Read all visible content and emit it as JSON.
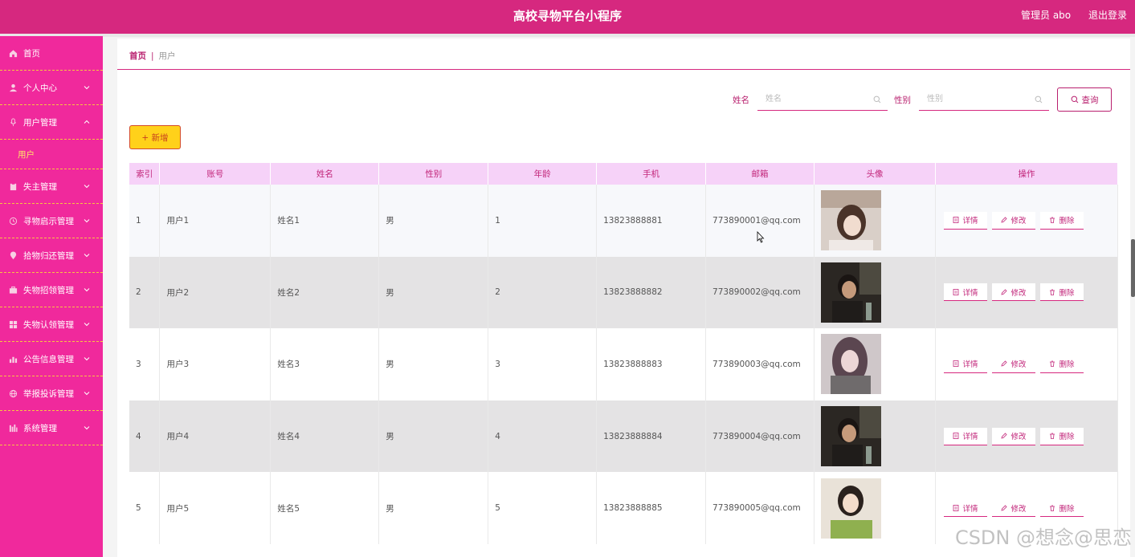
{
  "header": {
    "title": "高校寻物平台小程序",
    "admin": "管理员 abo",
    "logout": "退出登录"
  },
  "sidebar": {
    "items": [
      {
        "label": "首页",
        "icon": "home-icon"
      },
      {
        "label": "个人中心",
        "icon": "person-icon"
      },
      {
        "label": "用户管理",
        "icon": "mic-icon",
        "expanded": true,
        "sub": "用户"
      },
      {
        "label": "失主管理",
        "icon": "clipboard-icon"
      },
      {
        "label": "寻物启示管理",
        "icon": "clock-icon"
      },
      {
        "label": "拾物归还管理",
        "icon": "pin-icon"
      },
      {
        "label": "失物招领管理",
        "icon": "briefcase-icon"
      },
      {
        "label": "失物认领管理",
        "icon": "grid-icon"
      },
      {
        "label": "公告信息管理",
        "icon": "chart-icon"
      },
      {
        "label": "举报投诉管理",
        "icon": "globe-icon"
      },
      {
        "label": "系统管理",
        "icon": "bars-icon"
      }
    ]
  },
  "breadcrumb": {
    "home": "首页",
    "separator": "|",
    "current": "用户"
  },
  "search": {
    "name_label": "姓名",
    "name_placeholder": "姓名",
    "gender_label": "性别",
    "gender_placeholder": "性别",
    "query_button": "查询"
  },
  "add_button": "+ 新增",
  "table": {
    "columns": [
      "索引",
      "账号",
      "姓名",
      "性别",
      "年龄",
      "手机",
      "邮箱",
      "头像",
      "操作"
    ],
    "rows": [
      {
        "index": "1",
        "account": "用户1",
        "name": "姓名1",
        "gender": "男",
        "age": "1",
        "phone": "13823888881",
        "email": "773890001@qq.com"
      },
      {
        "index": "2",
        "account": "用户2",
        "name": "姓名2",
        "gender": "男",
        "age": "2",
        "phone": "13823888882",
        "email": "773890002@qq.com"
      },
      {
        "index": "3",
        "account": "用户3",
        "name": "姓名3",
        "gender": "男",
        "age": "3",
        "phone": "13823888883",
        "email": "773890003@qq.com"
      },
      {
        "index": "4",
        "account": "用户4",
        "name": "姓名4",
        "gender": "男",
        "age": "4",
        "phone": "13823888884",
        "email": "773890004@qq.com"
      },
      {
        "index": "5",
        "account": "用户5",
        "name": "姓名5",
        "gender": "男",
        "age": "5",
        "phone": "13823888885",
        "email": "773890005@qq.com"
      }
    ],
    "actions": {
      "detail": "详情",
      "edit": "修改",
      "delete": "删除"
    }
  },
  "watermark": "CSDN @想念@思恋",
  "colors": {
    "header": "#d6287f",
    "sidebar": "#f0299c",
    "accent": "#c2267a",
    "add": "#ffd11a"
  }
}
